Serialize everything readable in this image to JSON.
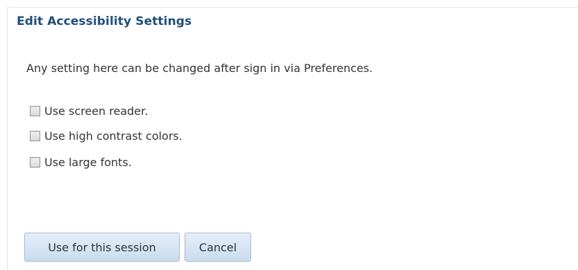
{
  "dialog": {
    "title": "Edit Accessibility Settings",
    "description": "Any setting here can be changed after sign in via Preferences.",
    "options": [
      {
        "label": "Use screen reader.",
        "checked": false
      },
      {
        "label": "Use high contrast colors.",
        "checked": false
      },
      {
        "label": "Use large fonts.",
        "checked": false
      }
    ],
    "buttons": {
      "use_session": "Use for this session",
      "cancel": "Cancel"
    }
  }
}
